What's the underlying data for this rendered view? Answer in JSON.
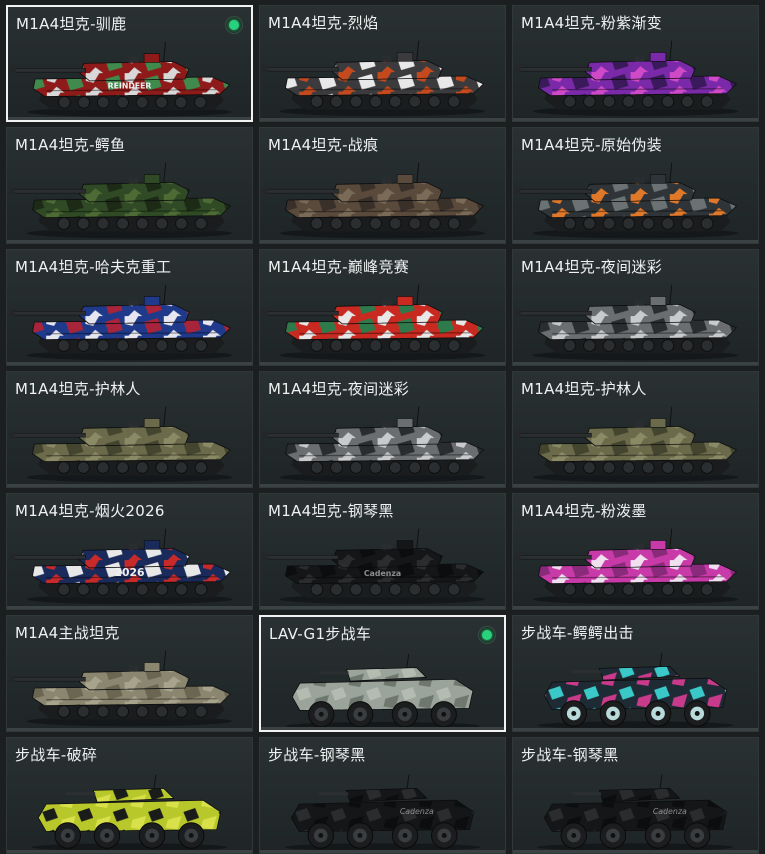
{
  "cards": [
    {
      "title": "M1A4坦克-驯鹿",
      "type": "tank",
      "c1": "#8e1a1a",
      "c2": "#d8d8d8",
      "c3": "#3f8a4c",
      "selected": true,
      "equipped": true,
      "decal": "REINDEER"
    },
    {
      "title": "M1A4坦克-烈焰",
      "type": "tank",
      "c1": "#3b3b3d",
      "c2": "#c44a1e",
      "c3": "#e8e8e8",
      "selected": false,
      "equipped": false,
      "decal": ""
    },
    {
      "title": "M1A4坦克-粉紫渐变",
      "type": "tank",
      "c1": "#7a2aa8",
      "c2": "#d04ac8",
      "c3": "#3a1a5a",
      "selected": false,
      "equipped": false,
      "decal": ""
    },
    {
      "title": "M1A4坦克-鳄鱼",
      "type": "tank",
      "c1": "#2f4a25",
      "c2": "#4e6b35",
      "c3": "#1c2a16",
      "selected": false,
      "equipped": false,
      "decal": ""
    },
    {
      "title": "M1A4坦克-战痕",
      "type": "tank",
      "c1": "#5a4a3c",
      "c2": "#7a6a58",
      "c3": "#3a302a",
      "selected": false,
      "equipped": false,
      "decal": ""
    },
    {
      "title": "M1A4坦克-原始伪装",
      "type": "tank",
      "c1": "#2e3437",
      "c2": "#e0782a",
      "c3": "#6a7274",
      "selected": false,
      "equipped": false,
      "decal": ""
    },
    {
      "title": "M1A4坦克-哈夫克重工",
      "type": "tank",
      "c1": "#1f3a8a",
      "c2": "#e6e6f0",
      "c3": "#a8243a",
      "selected": false,
      "equipped": false,
      "decal": ""
    },
    {
      "title": "M1A4坦克-巅峰竞赛",
      "type": "tank",
      "c1": "#c82a22",
      "c2": "#e8e8e8",
      "c3": "#2f7a4a",
      "selected": false,
      "equipped": false,
      "decal": ""
    },
    {
      "title": "M1A4坦克-夜间迷彩",
      "type": "tank",
      "c1": "#6a6e70",
      "c2": "#c8cacc",
      "c3": "#2a2d2f",
      "selected": false,
      "equipped": false,
      "decal": ""
    },
    {
      "title": "M1A4坦克-护林人",
      "type": "tank",
      "c1": "#6b6a4a",
      "c2": "#8a8a66",
      "c3": "#44452f",
      "selected": false,
      "equipped": false,
      "decal": ""
    },
    {
      "title": "M1A4坦克-夜间迷彩",
      "type": "tank",
      "c1": "#6a6e70",
      "c2": "#c8cacc",
      "c3": "#2a2d2f",
      "selected": false,
      "equipped": false,
      "decal": ""
    },
    {
      "title": "M1A4坦克-护林人",
      "type": "tank",
      "c1": "#6b6a4a",
      "c2": "#8a8a66",
      "c3": "#44452f",
      "selected": false,
      "equipped": false,
      "decal": ""
    },
    {
      "title": "M1A4坦克-烟火2026",
      "type": "tank",
      "c1": "#1a2a5a",
      "c2": "#c82a2a",
      "c3": "#e8e8e8",
      "selected": false,
      "equipped": false,
      "decal": "2026"
    },
    {
      "title": "M1A4坦克-钢琴黑",
      "type": "tank",
      "c1": "#151617",
      "c2": "#2a2c2e",
      "c3": "#0c0d0e",
      "selected": false,
      "equipped": false,
      "decal": "Cadenza"
    },
    {
      "title": "M1A4坦克-粉泼墨",
      "type": "tank",
      "c1": "#c83aa8",
      "c2": "#f0e0f0",
      "c3": "#8a2a7a",
      "selected": false,
      "equipped": false,
      "decal": ""
    },
    {
      "title": "M1A4主战坦克",
      "type": "tank",
      "c1": "#8a8670",
      "c2": "#a8a48c",
      "c3": "#6a6652",
      "selected": false,
      "equipped": false,
      "decal": ""
    },
    {
      "title": "LAV-G1步战车",
      "type": "ifv",
      "c1": "#9aa49a",
      "c2": "#b4bcb2",
      "c3": "#6e786e",
      "selected": true,
      "equipped": true,
      "decal": ""
    },
    {
      "title": "步战车-鳄鳄出击",
      "type": "ifv",
      "c1": "#1e2a34",
      "c2": "#3ac8c8",
      "c3": "#c83a8a",
      "selected": false,
      "equipped": false,
      "decal": ""
    },
    {
      "title": "步战车-破碎",
      "type": "ifv",
      "c1": "#b8c82a",
      "c2": "#1a1c1a",
      "c3": "#d8e04a",
      "selected": false,
      "equipped": false,
      "decal": ""
    },
    {
      "title": "步战车-钢琴黑",
      "type": "ifv",
      "c1": "#151617",
      "c2": "#2a2c2e",
      "c3": "#0c0d0e",
      "selected": false,
      "equipped": false,
      "decal": "Cadenza"
    },
    {
      "title": "步战车-钢琴黑",
      "type": "ifv",
      "c1": "#151617",
      "c2": "#2a2c2e",
      "c3": "#0c0d0e",
      "selected": false,
      "equipped": false,
      "decal": "Cadenza"
    }
  ]
}
